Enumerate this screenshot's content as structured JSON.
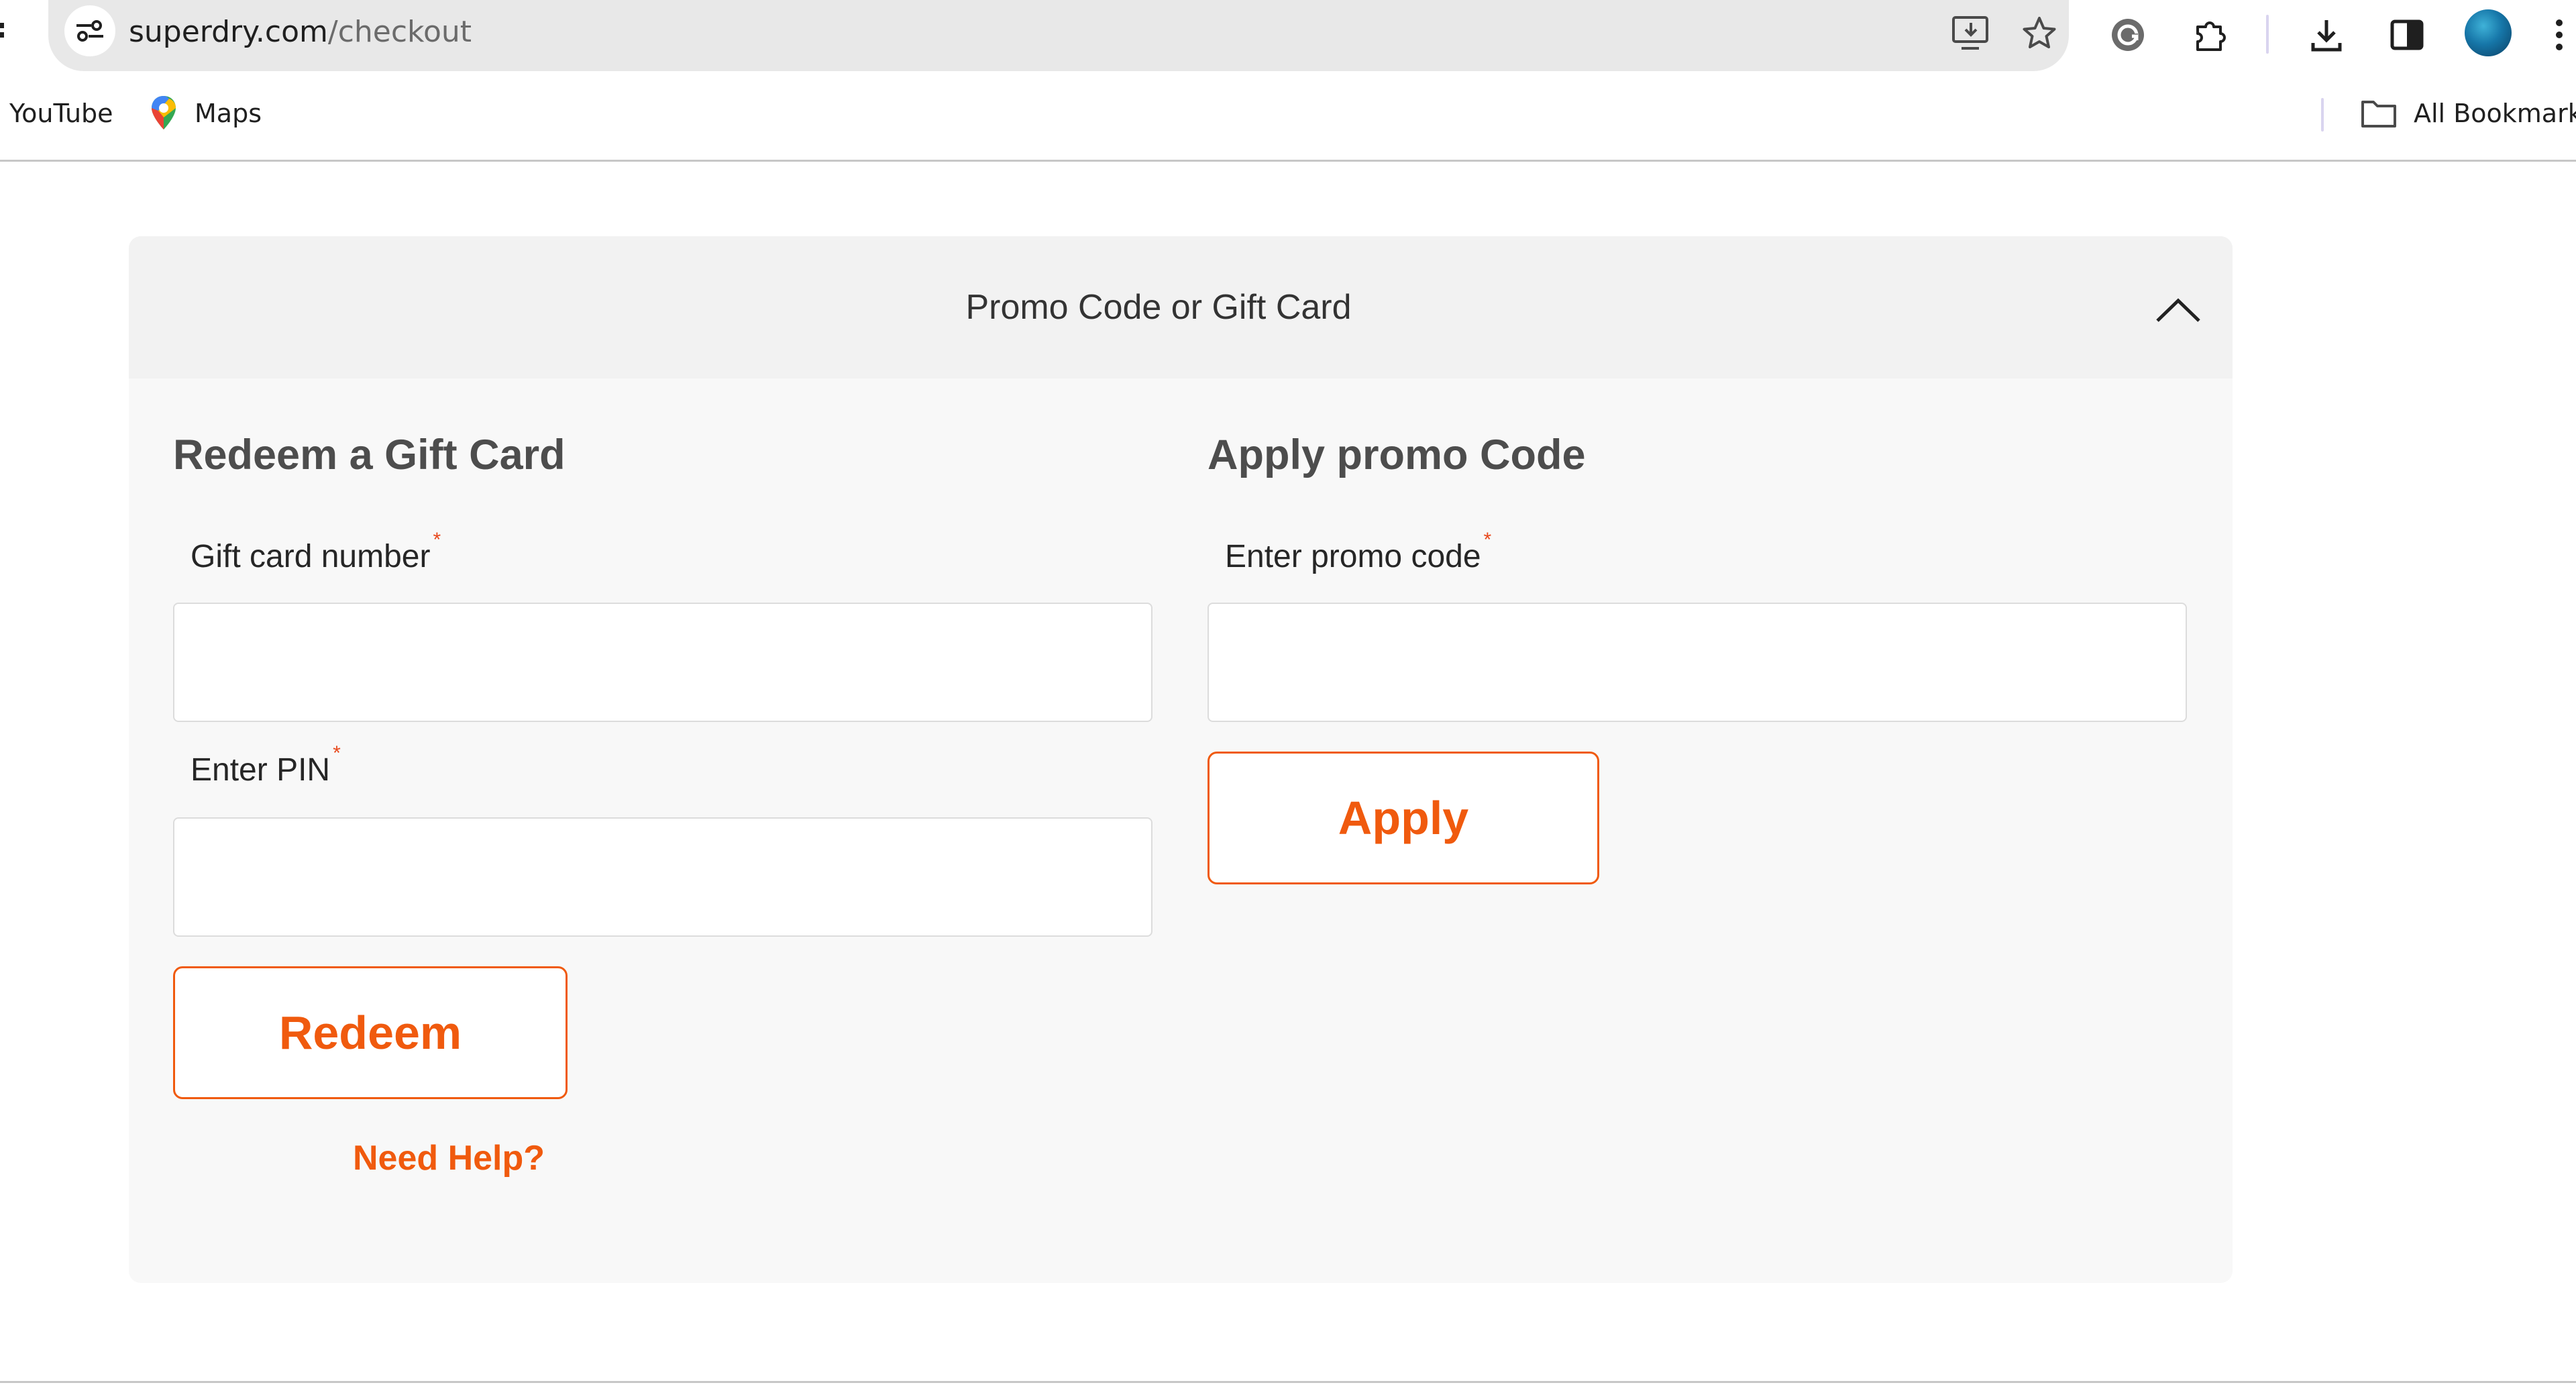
{
  "browser": {
    "url_host": "superdry.com",
    "url_path": "/checkout",
    "bookmarks": [
      {
        "label": "YouTube",
        "icon": "youtube-icon"
      },
      {
        "label": "Maps",
        "icon": "maps-pin-icon"
      }
    ],
    "all_bookmarks_label": "All Bookmarks",
    "toolbar_icons": [
      "install-app-icon",
      "star-icon",
      "grammarly-icon",
      "extensions-icon",
      "download-icon",
      "side-panel-icon",
      "profile-avatar",
      "menu-kebab-icon"
    ]
  },
  "promo_panel": {
    "title": "Promo Code or Gift Card",
    "expanded": true,
    "gift_card": {
      "heading": "Redeem a Gift Card",
      "number_label": "Gift card number",
      "number_value": "",
      "pin_label": "Enter PIN",
      "pin_value": "",
      "required_mark": "*",
      "redeem_label": "Redeem",
      "help_label": "Need Help?"
    },
    "promo": {
      "heading": "Apply promo Code",
      "code_label": "Enter promo code",
      "code_value": "",
      "required_mark": "*",
      "apply_label": "Apply"
    }
  },
  "colors": {
    "accent": "#f05a0e",
    "required": "#e8491d",
    "panel_bg": "#f8f8f8",
    "panel_header_bg": "#f2f2f2"
  }
}
